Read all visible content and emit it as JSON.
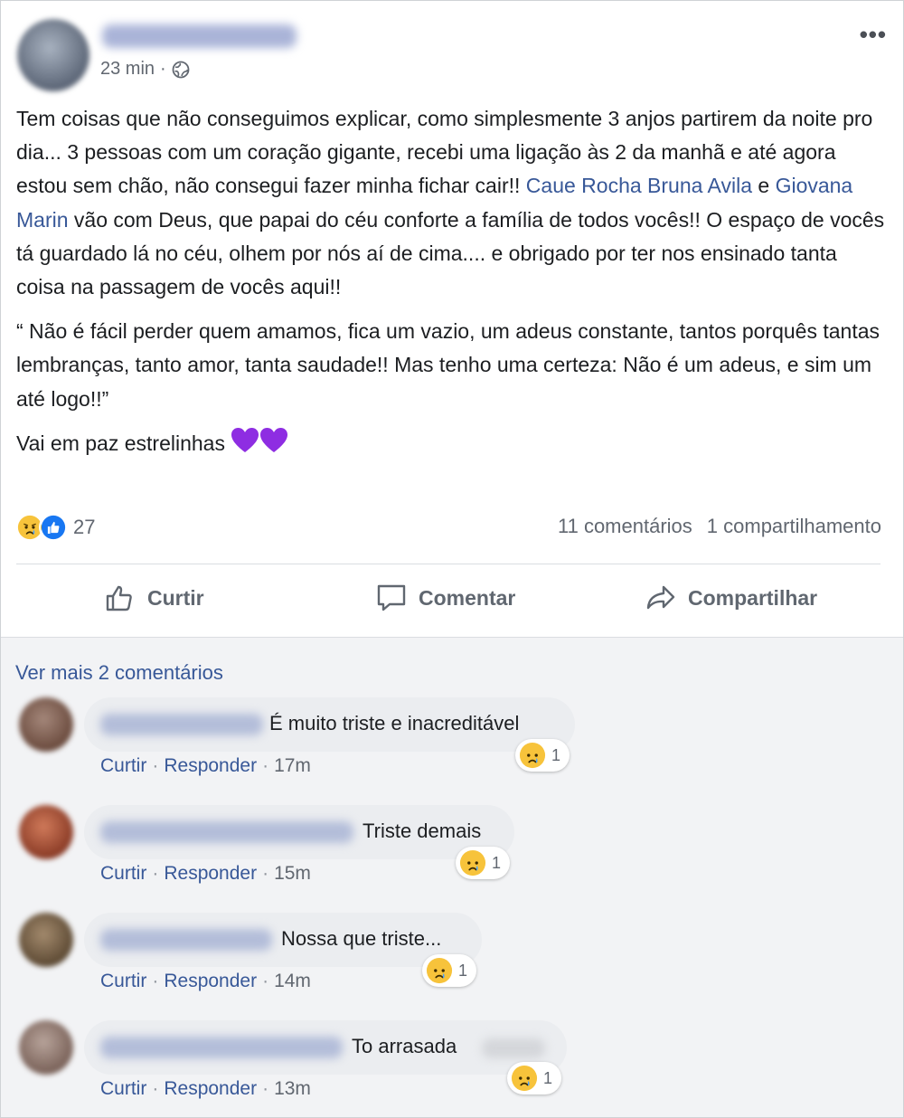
{
  "post": {
    "time": "23 min",
    "time_separator": "·",
    "more_icon": "ellipsis-icon",
    "paragraph1_a": "Tem coisas que não conseguimos explicar, como simplesmente 3 anjos partirem da noite pro dia... 3 pessoas com um coração gigante, recebi uma ligação às 2 da manhã e até agora estou sem chão, não consegui fazer minha fichar cair!! ",
    "tag1": "Caue Rocha",
    "tag2": "Bruna Avila",
    "conj": " e ",
    "tag3": "Giovana Marin",
    "paragraph1_b": " vão com Deus, que papai do céu conforte a família de todos vocês!! O espaço de vocês tá guardado lá no céu, olhem por nós aí de cima.... e obrigado por ter nos ensinado tanta coisa na passagem de vocês aqui!!",
    "paragraph2": "“ Não é fácil perder quem amamos, fica um vazio, um adeus constante, tantos porquês tantas lembranças, tanto amor, tanta saudade!! Mas tenho uma certeza: Não é um adeus, e sim um até logo!!”",
    "paragraph3": "Vai em paz estrelinhas ",
    "reaction_count": "27",
    "comments_count": "11 comentários",
    "shares_count": "1 compartilhamento"
  },
  "actions": {
    "like": "Curtir",
    "comment": "Comentar",
    "share": "Compartilhar"
  },
  "comments_section": {
    "see_more": "Ver mais 2 comentários",
    "items": [
      {
        "text": "É muito triste e inacreditável",
        "like": "Curtir",
        "reply": "Responder",
        "time": "17m",
        "reactions": "1"
      },
      {
        "text": "Triste demais",
        "like": "Curtir",
        "reply": "Responder",
        "time": "15m",
        "reactions": "1"
      },
      {
        "text": "Nossa que triste...",
        "like": "Curtir",
        "reply": "Responder",
        "time": "14m",
        "reactions": "1"
      },
      {
        "text": "To arrasada",
        "like": "Curtir",
        "reply": "Responder",
        "time": "13m",
        "reactions": "1"
      }
    ]
  },
  "colors": {
    "link": "#385898",
    "secondary_text": "#616770",
    "bubble": "#ebedf0",
    "like_blue": "#1877f2",
    "sad_yellow": "#f7c33b",
    "heart_purple": "#8e2de2"
  }
}
